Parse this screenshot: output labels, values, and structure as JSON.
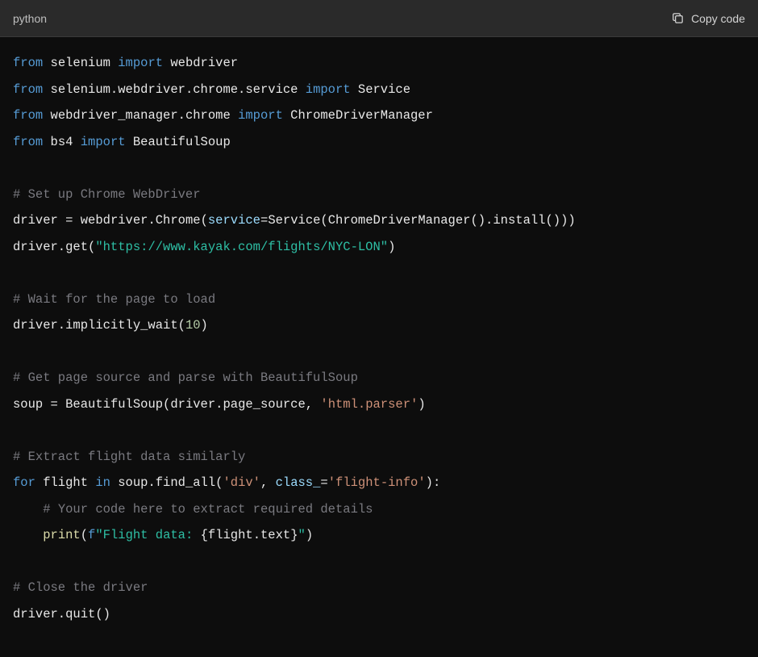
{
  "header": {
    "language": "python",
    "copy_label": "Copy code"
  },
  "code": {
    "lines": [
      [
        {
          "cls": "tok-keyword",
          "t": "from"
        },
        {
          "cls": "tok-module",
          "t": " selenium "
        },
        {
          "cls": "tok-keyword",
          "t": "import"
        },
        {
          "cls": "tok-module",
          "t": " webdriver"
        }
      ],
      [
        {
          "cls": "tok-keyword",
          "t": "from"
        },
        {
          "cls": "tok-module",
          "t": " selenium.webdriver.chrome.service "
        },
        {
          "cls": "tok-keyword",
          "t": "import"
        },
        {
          "cls": "tok-module",
          "t": " Service"
        }
      ],
      [
        {
          "cls": "tok-keyword",
          "t": "from"
        },
        {
          "cls": "tok-module",
          "t": " webdriver_manager.chrome "
        },
        {
          "cls": "tok-keyword",
          "t": "import"
        },
        {
          "cls": "tok-module",
          "t": " ChromeDriverManager"
        }
      ],
      [
        {
          "cls": "tok-keyword",
          "t": "from"
        },
        {
          "cls": "tok-module",
          "t": " bs4 "
        },
        {
          "cls": "tok-keyword",
          "t": "import"
        },
        {
          "cls": "tok-module",
          "t": " BeautifulSoup"
        }
      ],
      [],
      [
        {
          "cls": "tok-comment",
          "t": "# Set up Chrome WebDriver"
        }
      ],
      [
        {
          "cls": "tok-name",
          "t": "driver "
        },
        {
          "cls": "tok-operator",
          "t": "="
        },
        {
          "cls": "tok-name",
          "t": " webdriver.Chrome("
        },
        {
          "cls": "tok-param",
          "t": "service"
        },
        {
          "cls": "tok-operator",
          "t": "="
        },
        {
          "cls": "tok-name",
          "t": "Service(ChromeDriverManager().install()))"
        }
      ],
      [
        {
          "cls": "tok-name",
          "t": "driver.get("
        },
        {
          "cls": "tok-string",
          "t": "\"https://www.kayak.com/flights/NYC-LON\""
        },
        {
          "cls": "tok-name",
          "t": ")"
        }
      ],
      [],
      [
        {
          "cls": "tok-comment",
          "t": "# Wait for the page to load"
        }
      ],
      [
        {
          "cls": "tok-name",
          "t": "driver.implicitly_wait("
        },
        {
          "cls": "tok-number",
          "t": "10"
        },
        {
          "cls": "tok-name",
          "t": ")"
        }
      ],
      [],
      [
        {
          "cls": "tok-comment",
          "t": "# Get page source and parse with BeautifulSoup"
        }
      ],
      [
        {
          "cls": "tok-name",
          "t": "soup "
        },
        {
          "cls": "tok-operator",
          "t": "="
        },
        {
          "cls": "tok-name",
          "t": " BeautifulSoup(driver.page_source, "
        },
        {
          "cls": "tok-string-s",
          "t": "'html.parser'"
        },
        {
          "cls": "tok-name",
          "t": ")"
        }
      ],
      [],
      [
        {
          "cls": "tok-comment",
          "t": "# Extract flight data similarly"
        }
      ],
      [
        {
          "cls": "tok-keyword",
          "t": "for"
        },
        {
          "cls": "tok-name",
          "t": " flight "
        },
        {
          "cls": "tok-keyword",
          "t": "in"
        },
        {
          "cls": "tok-name",
          "t": " soup.find_all("
        },
        {
          "cls": "tok-string-s",
          "t": "'div'"
        },
        {
          "cls": "tok-name",
          "t": ", "
        },
        {
          "cls": "tok-param",
          "t": "class_"
        },
        {
          "cls": "tok-operator",
          "t": "="
        },
        {
          "cls": "tok-string-s",
          "t": "'flight-info'"
        },
        {
          "cls": "tok-name",
          "t": "):"
        }
      ],
      [
        {
          "cls": "tok-name",
          "t": "    "
        },
        {
          "cls": "tok-comment",
          "t": "# Your code here to extract required details"
        }
      ],
      [
        {
          "cls": "tok-name",
          "t": "    "
        },
        {
          "cls": "tok-function",
          "t": "print"
        },
        {
          "cls": "tok-name",
          "t": "("
        },
        {
          "cls": "tok-keyword",
          "t": "f"
        },
        {
          "cls": "tok-fstring",
          "t": "\"Flight data: "
        },
        {
          "cls": "tok-name",
          "t": "{flight.text}"
        },
        {
          "cls": "tok-fstring",
          "t": "\""
        },
        {
          "cls": "tok-name",
          "t": ")"
        }
      ],
      [],
      [
        {
          "cls": "tok-comment",
          "t": "# Close the driver"
        }
      ],
      [
        {
          "cls": "tok-name",
          "t": "driver.quit()"
        }
      ]
    ]
  }
}
